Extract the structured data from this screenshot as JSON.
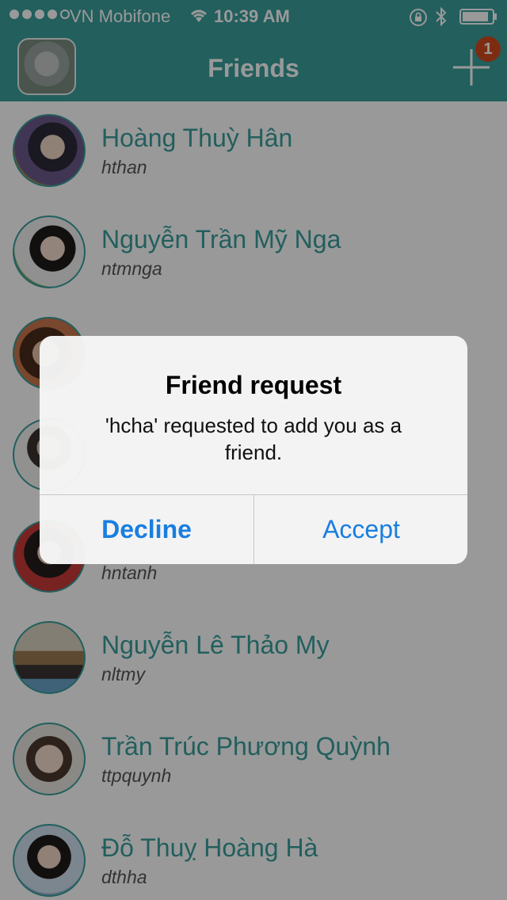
{
  "status_bar": {
    "carrier": "VN Mobifone",
    "time": "10:39 AM",
    "signal_dots": 5,
    "signal_filled": 4,
    "icons": [
      "wifi-icon",
      "rotation-lock-icon",
      "bluetooth-icon",
      "battery-icon"
    ]
  },
  "nav": {
    "title": "Friends",
    "add_icon": "plus-icon",
    "badge_count": "1"
  },
  "friends": [
    {
      "name": "Hoàng Thuỳ Hân",
      "username": "hthan"
    },
    {
      "name": "Nguyễn Trần Mỹ Nga",
      "username": "ntmnga"
    },
    {
      "name": "",
      "username": ""
    },
    {
      "name": "",
      "username": ""
    },
    {
      "name": "",
      "username": "hntanh"
    },
    {
      "name": "Nguyễn Lê Thảo My",
      "username": "nltmy"
    },
    {
      "name": "Trần Trúc Phương Quỳnh",
      "username": "ttpquynh"
    },
    {
      "name": "Đỗ Thuỵ Hoàng Hà",
      "username": "dthha"
    }
  ],
  "alert": {
    "title": "Friend request",
    "message": "'hcha' requested to add you as a friend.",
    "decline_label": "Decline",
    "accept_label": "Accept"
  },
  "colors": {
    "accent": "#3a9e9b",
    "badge": "#d24a1d",
    "alert_button": "#1a7ee0"
  }
}
